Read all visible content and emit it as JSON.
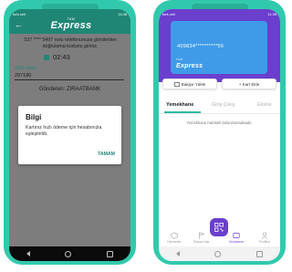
{
  "brand": {
    "small": "TAM",
    "big": "Express"
  },
  "left_screen": {
    "status_left": "turk.cell",
    "status_right": "11:38",
    "message": "537 **** 5497 nolu telefonunuza gönderilen doğrulama kodunu giriniz.",
    "timer": "02:43",
    "sms_label": "SMS Kodu",
    "sms_value": "297180",
    "sender": "Gönderen: ZIRAATBANK",
    "dialog": {
      "title": "Bilgi",
      "message": "Kartınız hızlı ödeme için hesabınızla eşleştirildi.",
      "ok_label": "TAMAM"
    }
  },
  "right_screen": {
    "status_left": "turk.cell",
    "status_right": "11:38",
    "card_number": "409834**********56",
    "buttons": {
      "balance": "Bakiye Yükle",
      "add_card": "+ Kart Ekle"
    },
    "tabs": [
      "Yemekhane",
      "Giriş Çıkış",
      "Ekstre"
    ],
    "empty_message": "Yemekhane hareketi bulunmamaktadır.",
    "bottom_tabs": [
      "Hizmetler",
      "Başvurular",
      "Cüzdanım",
      "Profilim"
    ],
    "colors": {
      "accent": "#6a3fce",
      "teal": "#2fb9a3",
      "card": "#3f9be8"
    }
  }
}
